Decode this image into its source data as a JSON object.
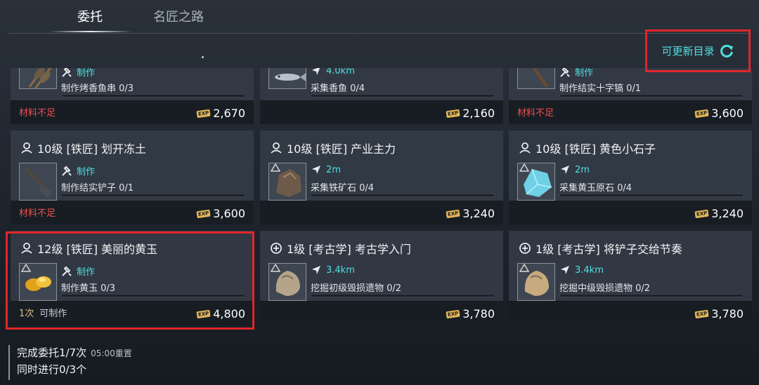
{
  "tabs": [
    {
      "label": "委托",
      "active": true
    },
    {
      "label": "名匠之路",
      "active": false
    }
  ],
  "refresh": {
    "label": "可更新目录"
  },
  "cards": [
    {
      "title": "",
      "type": "制作",
      "desc": "制作烤香鱼串 0/3",
      "foot": "材料不足",
      "foot_kind": "warn",
      "exp": "2,670",
      "thumb": "fish-skewer-icon"
    },
    {
      "title": "",
      "type": "4.0km",
      "desc": "采集香鱼 0/4",
      "foot": "",
      "foot_kind": "",
      "exp": "2,160",
      "thumb": "fish-icon"
    },
    {
      "title": "",
      "type": "制作",
      "desc": "制作结实十字镐 0/1",
      "foot": "材料不足",
      "foot_kind": "warn",
      "exp": "3,600",
      "thumb": "pickaxe-icon"
    },
    {
      "title": "10级 [铁匠] 划开冻土",
      "type": "制作",
      "desc": "制作结实铲子 0/1",
      "foot": "材料不足",
      "foot_kind": "warn",
      "exp": "3,600",
      "thumb": "shovel-icon"
    },
    {
      "title": "10级 [铁匠] 产业主力",
      "type": "2m",
      "desc": "采集铁矿石 0/4",
      "foot": "",
      "foot_kind": "",
      "exp": "3,240",
      "thumb": "iron-ore-icon"
    },
    {
      "title": "10级 [铁匠] 黄色小石子",
      "type": "2m",
      "desc": "采集黄玉原石 0/4",
      "foot": "",
      "foot_kind": "",
      "exp": "3,240",
      "thumb": "topaz-ore-icon"
    },
    {
      "title": "12级 [铁匠] 美丽的黄玉",
      "type": "制作",
      "desc": "制作黄玉 0/3",
      "foot": "1次",
      "foot_sub": "可制作",
      "foot_kind": "ready",
      "exp": "4,800",
      "thumb": "topaz-icon"
    },
    {
      "title": "1级 [考古学] 考古学入门",
      "type": "3.4km",
      "desc": "挖掘初级毁损遗物 0/2",
      "foot": "",
      "foot_kind": "",
      "exp": "3,780",
      "thumb": "relic-icon"
    },
    {
      "title": "1级 [考古学] 将铲子交给节奏",
      "type": "3.4km",
      "desc": "挖掘中级毁损遗物 0/2",
      "foot": "",
      "foot_kind": "",
      "exp": "3,780",
      "thumb": "relic-icon"
    }
  ],
  "exp_badge": "EXP",
  "status": {
    "completed": "完成委托1/7次",
    "reset": "05:00重置",
    "concurrent": "同时进行0/3个"
  },
  "colors": {
    "accent": "#4ee0e0",
    "warning": "#f04e4e",
    "highlight": "#e1262a",
    "exp": "#e2b659"
  }
}
